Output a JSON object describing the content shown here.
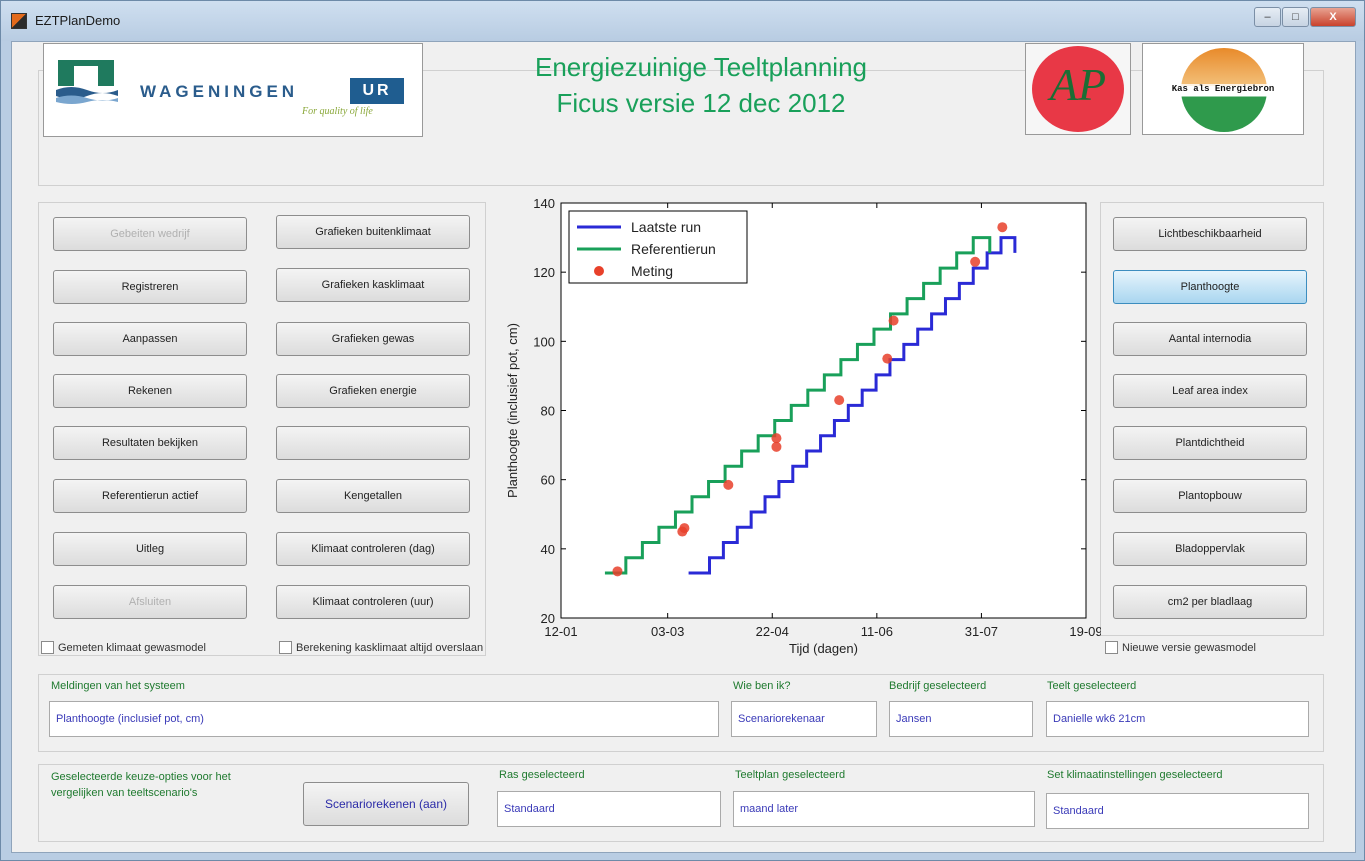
{
  "window": {
    "title": "EZTPlanDemo",
    "controls": {
      "minimize": "–",
      "maximize": "□",
      "close": "X"
    }
  },
  "header": {
    "title_line1": "Energiezuinige Teeltplanning",
    "title_line2": "Ficus versie 12 dec 2012",
    "logos": {
      "wur_name": "WAGENINGEN",
      "wur_ur": "UR",
      "wur_tagline": "For quality of life",
      "ap_text": "AP",
      "kas_text": "Kas als Energiebron"
    }
  },
  "left_buttons": [
    {
      "label": "Gebeiten wedrijf",
      "enabled": false
    },
    {
      "label": "Registreren",
      "enabled": true
    },
    {
      "label": "Aanpassen",
      "enabled": true
    },
    {
      "label": "Rekenen",
      "enabled": true
    },
    {
      "label": "Resultaten bekijken",
      "enabled": true
    },
    {
      "label": "Referentierun actief",
      "enabled": true
    },
    {
      "label": "Uitleg",
      "enabled": true
    },
    {
      "label": "Afsluiten",
      "enabled": false
    }
  ],
  "middle_buttons": [
    {
      "label": "Grafieken buitenklimaat"
    },
    {
      "label": "Grafieken kasklimaat"
    },
    {
      "label": "Grafieken gewas"
    },
    {
      "label": "Grafieken energie"
    },
    {
      "label": ""
    },
    {
      "label": "Kengetallen"
    },
    {
      "label": "Klimaat controleren (dag)"
    },
    {
      "label": "Klimaat controleren (uur)"
    }
  ],
  "right_buttons": [
    {
      "label": "Lichtbeschikbaarheid",
      "active": false
    },
    {
      "label": "Planthoogte",
      "active": true
    },
    {
      "label": "Aantal internodia",
      "active": false
    },
    {
      "label": "Leaf area index",
      "active": false
    },
    {
      "label": "Plantdichtheid",
      "active": false
    },
    {
      "label": "Plantopbouw",
      "active": false
    },
    {
      "label": "Bladoppervlak",
      "active": false
    },
    {
      "label": "cm2 per bladlaag",
      "active": false
    }
  ],
  "checkboxes": {
    "gemeten": "Gemeten klimaat gewasmodel",
    "berekening": "Berekening kasklimaat altijd overslaan",
    "nieuwe": "Nieuwe versie gewasmodel"
  },
  "messages": {
    "meldingen_label": "Meldingen van het systeem",
    "meldingen_value": "Planthoogte (inclusief pot, cm)",
    "wie_label": "Wie ben ik?",
    "wie_value": "Scenariorekenaar",
    "bedrijf_label": "Bedrijf geselecteerd",
    "bedrijf_value": "Jansen",
    "teelt_label": "Teelt geselecteerd",
    "teelt_value": "Danielle wk6 21cm"
  },
  "scenario": {
    "description": "Geselecteerde keuze-opties voor het vergelijken van teeltscenario's",
    "button": "Scenariorekenen (aan)",
    "ras_label": "Ras geselecteerd",
    "ras_value": "Standaard",
    "teeltplan_label": "Teeltplan geselecteerd",
    "teeltplan_value": "maand later",
    "set_label": "Set klimaatinstellingen geselecteerd",
    "set_value": "Standaard"
  },
  "chart_data": {
    "type": "line",
    "title": "",
    "xlabel": "Tijd (dagen)",
    "ylabel": "Planthoogte (inclusief pot, cm)",
    "ylim": [
      20,
      140
    ],
    "yticks": [
      20,
      40,
      60,
      80,
      100,
      120,
      140
    ],
    "xlim": [
      "12-01",
      "19-09"
    ],
    "xticks": [
      "12-01",
      "03-03",
      "22-04",
      "11-06",
      "31-07",
      "19-09"
    ],
    "legend_position": "top-left",
    "series": [
      {
        "name": "Laatste run",
        "style": "step",
        "color": "#2a2ad6",
        "x_start": "13-03",
        "y_start": 33,
        "x_end": "16-08",
        "y_end": 130
      },
      {
        "name": "Referentierun",
        "style": "step",
        "color": "#19a05a",
        "x_start": "02-02",
        "y_start": 33,
        "x_end": "04-08",
        "y_end": 130
      },
      {
        "name": "Meting",
        "style": "markers",
        "color": "#e8402a",
        "points": [
          [
            "08-02",
            33.5
          ],
          [
            "10-03",
            45
          ],
          [
            "11-03",
            46
          ],
          [
            "01-04",
            58.5
          ],
          [
            "24-04",
            72
          ],
          [
            "24-04",
            69.5
          ],
          [
            "24-05",
            83
          ],
          [
            "16-06",
            95
          ],
          [
            "19-06",
            106
          ],
          [
            "28-07",
            123
          ],
          [
            "10-08",
            133
          ]
        ]
      }
    ]
  }
}
